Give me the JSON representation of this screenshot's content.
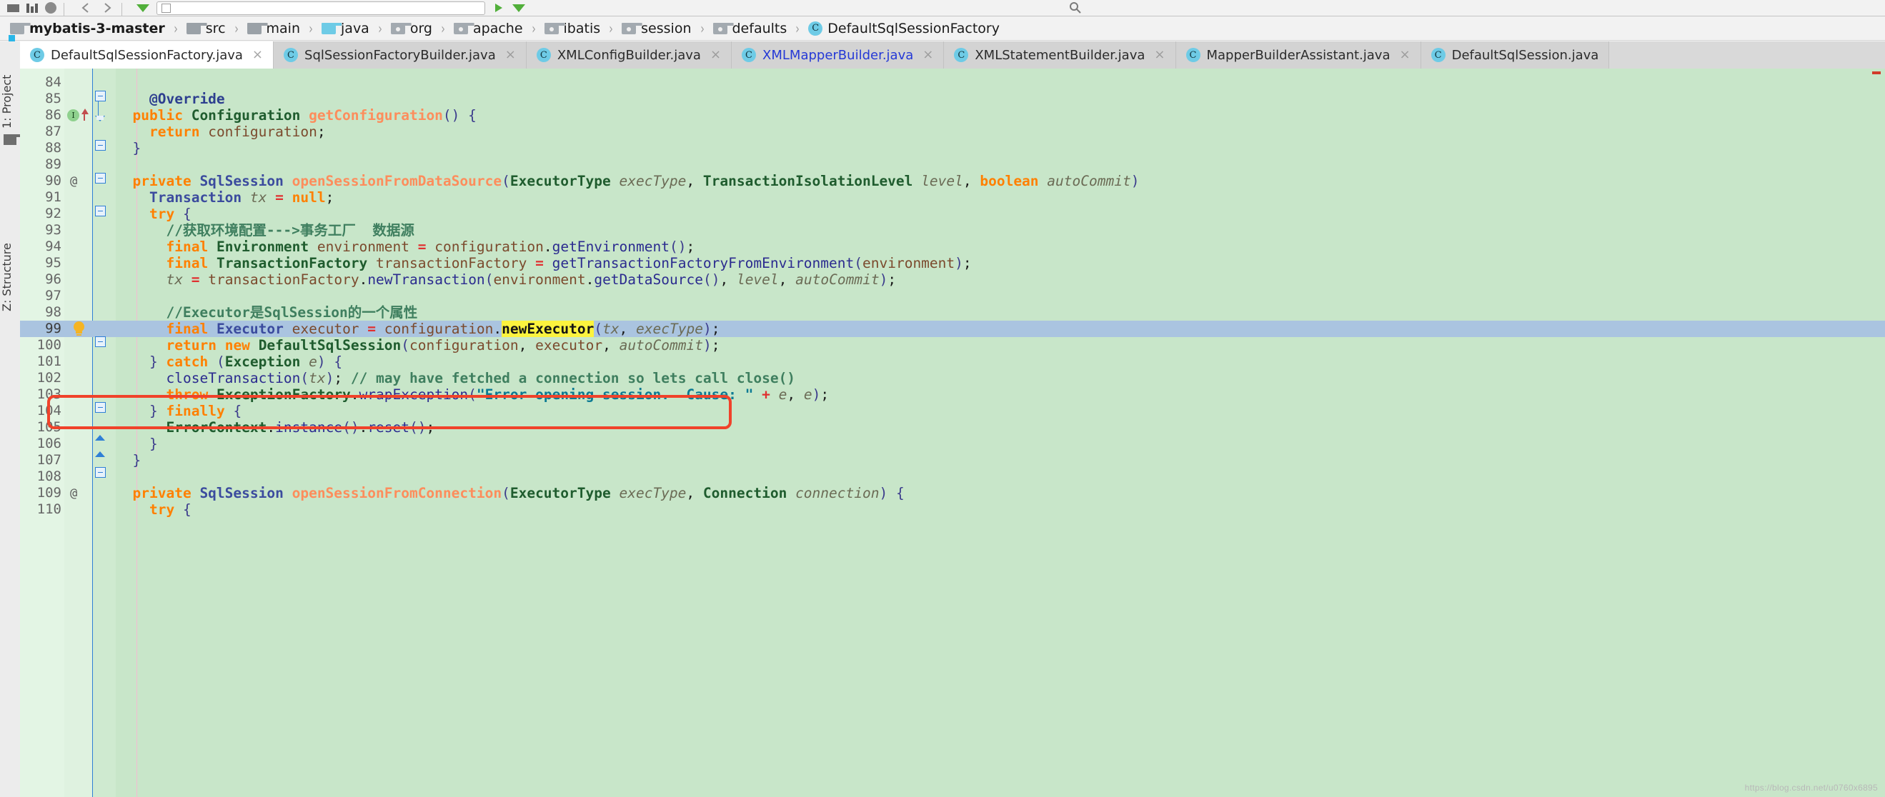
{
  "window": {
    "ide": "IntelliJ IDEA",
    "accent_color": "#6ecbe6",
    "editor_background": "#c8e6c9",
    "current_line_highlight": "#aac4e0",
    "search_highlight": "#fcf33e",
    "annotation_box_color": "#f0422a"
  },
  "toolbar": {
    "run_config_value": "",
    "run_config_placeholder": "",
    "items": [
      {
        "name": "stop-icon",
        "label": ""
      },
      {
        "name": "bars-icon",
        "label": ""
      },
      {
        "name": "circle-icon",
        "label": ""
      },
      {
        "name": "back-arrow-icon",
        "label": ""
      },
      {
        "name": "forward-arrow-icon",
        "label": ""
      },
      {
        "name": "run-icon",
        "label": ""
      },
      {
        "name": "debug-icon",
        "label": ""
      },
      {
        "name": "search-icon",
        "label": ""
      }
    ]
  },
  "breadcrumb": {
    "items": [
      {
        "label": "mybatis-3-master",
        "icon": "module-folder-icon",
        "kind": "module"
      },
      {
        "label": "src",
        "icon": "folder-icon",
        "kind": "folder"
      },
      {
        "label": "main",
        "icon": "folder-icon",
        "kind": "folder"
      },
      {
        "label": "java",
        "icon": "source-root-folder-icon",
        "kind": "source-root"
      },
      {
        "label": "org",
        "icon": "package-icon",
        "kind": "package"
      },
      {
        "label": "apache",
        "icon": "package-icon",
        "kind": "package"
      },
      {
        "label": "ibatis",
        "icon": "package-icon",
        "kind": "package"
      },
      {
        "label": "session",
        "icon": "package-icon",
        "kind": "package"
      },
      {
        "label": "defaults",
        "icon": "package-icon",
        "kind": "package"
      },
      {
        "label": "DefaultSqlSessionFactory",
        "icon": "class-icon",
        "kind": "class"
      }
    ],
    "separator": "›"
  },
  "left_tool_strip": {
    "project_label": "1: Project",
    "structure_label": "Z: Structure",
    "folder_icon": "folder-icon"
  },
  "tabs": {
    "close_glyph": "×",
    "items": [
      {
        "label": "DefaultSqlSessionFactory.java",
        "icon": "class-icon",
        "active": true,
        "closable": true,
        "title_color": "#2b2b2b"
      },
      {
        "label": "SqlSessionFactoryBuilder.java",
        "icon": "class-icon",
        "active": false,
        "closable": true,
        "title_color": "#2b2b2b"
      },
      {
        "label": "XMLConfigBuilder.java",
        "icon": "class-icon",
        "active": false,
        "closable": true,
        "title_color": "#2b2b2b"
      },
      {
        "label": "XMLMapperBuilder.java",
        "icon": "class-icon",
        "active": false,
        "closable": true,
        "title_color": "#2539d6"
      },
      {
        "label": "XMLStatementBuilder.java",
        "icon": "class-icon",
        "active": false,
        "closable": true,
        "title_color": "#2b2b2b"
      },
      {
        "label": "MapperBuilderAssistant.java",
        "icon": "class-icon",
        "active": false,
        "closable": true,
        "title_color": "#2b2b2b"
      },
      {
        "label": "DefaultSqlSession.java",
        "icon": "class-icon",
        "active": false,
        "closable": false,
        "title_color": "#2b2b2b"
      }
    ]
  },
  "editor": {
    "file": "DefaultSqlSessionFactory.java",
    "current_line_number": 99,
    "highlighted_token": "newExecutor",
    "first_visible_line": 84,
    "last_visible_line": 110,
    "lines": [
      {
        "n": 84,
        "text": ""
      },
      {
        "n": 85,
        "text": "    @Override"
      },
      {
        "n": 86,
        "text": "  public Configuration getConfiguration() {",
        "gutter": "override-marker"
      },
      {
        "n": 87,
        "text": "    return configuration;"
      },
      {
        "n": 88,
        "text": "  }"
      },
      {
        "n": 89,
        "text": ""
      },
      {
        "n": 90,
        "text": "  private SqlSession openSessionFromDataSource(ExecutorType execType, TransactionIsolationLevel level, boolean autoCommit)",
        "gutter": "at-marker"
      },
      {
        "n": 91,
        "text": "    Transaction tx = null;"
      },
      {
        "n": 92,
        "text": "    try {"
      },
      {
        "n": 93,
        "text": "      //获取环境配置--->事务工厂  数据源"
      },
      {
        "n": 94,
        "text": "      final Environment environment = configuration.getEnvironment();"
      },
      {
        "n": 95,
        "text": "      final TransactionFactory transactionFactory = getTransactionFactoryFromEnvironment(environment);"
      },
      {
        "n": 96,
        "text": "      tx = transactionFactory.newTransaction(environment.getDataSource(), level, autoCommit);"
      },
      {
        "n": 97,
        "text": ""
      },
      {
        "n": 98,
        "text": "      //Executor是SqlSession的一个属性"
      },
      {
        "n": 99,
        "text": "      final Executor executor = configuration.newExecutor(tx, execType);",
        "gutter": "intention-bulb",
        "current": true
      },
      {
        "n": 100,
        "text": "      return new DefaultSqlSession(configuration, executor, autoCommit);"
      },
      {
        "n": 101,
        "text": "    } catch (Exception e) {"
      },
      {
        "n": 102,
        "text": "      closeTransaction(tx); // may have fetched a connection so lets call close()"
      },
      {
        "n": 103,
        "text": "      throw ExceptionFactory.wrapException(\"Error opening session.  Cause: \" + e, e);"
      },
      {
        "n": 104,
        "text": "    } finally {"
      },
      {
        "n": 105,
        "text": "      ErrorContext.instance().reset();"
      },
      {
        "n": 106,
        "text": "    }"
      },
      {
        "n": 107,
        "text": "  }"
      },
      {
        "n": 108,
        "text": ""
      },
      {
        "n": 109,
        "text": "  private SqlSession openSessionFromConnection(ExecutorType execType, Connection connection) {",
        "gutter": "at-marker"
      },
      {
        "n": 110,
        "text": "    try {"
      }
    ]
  },
  "watermark": "https://blog.csdn.net/u0760x6895"
}
